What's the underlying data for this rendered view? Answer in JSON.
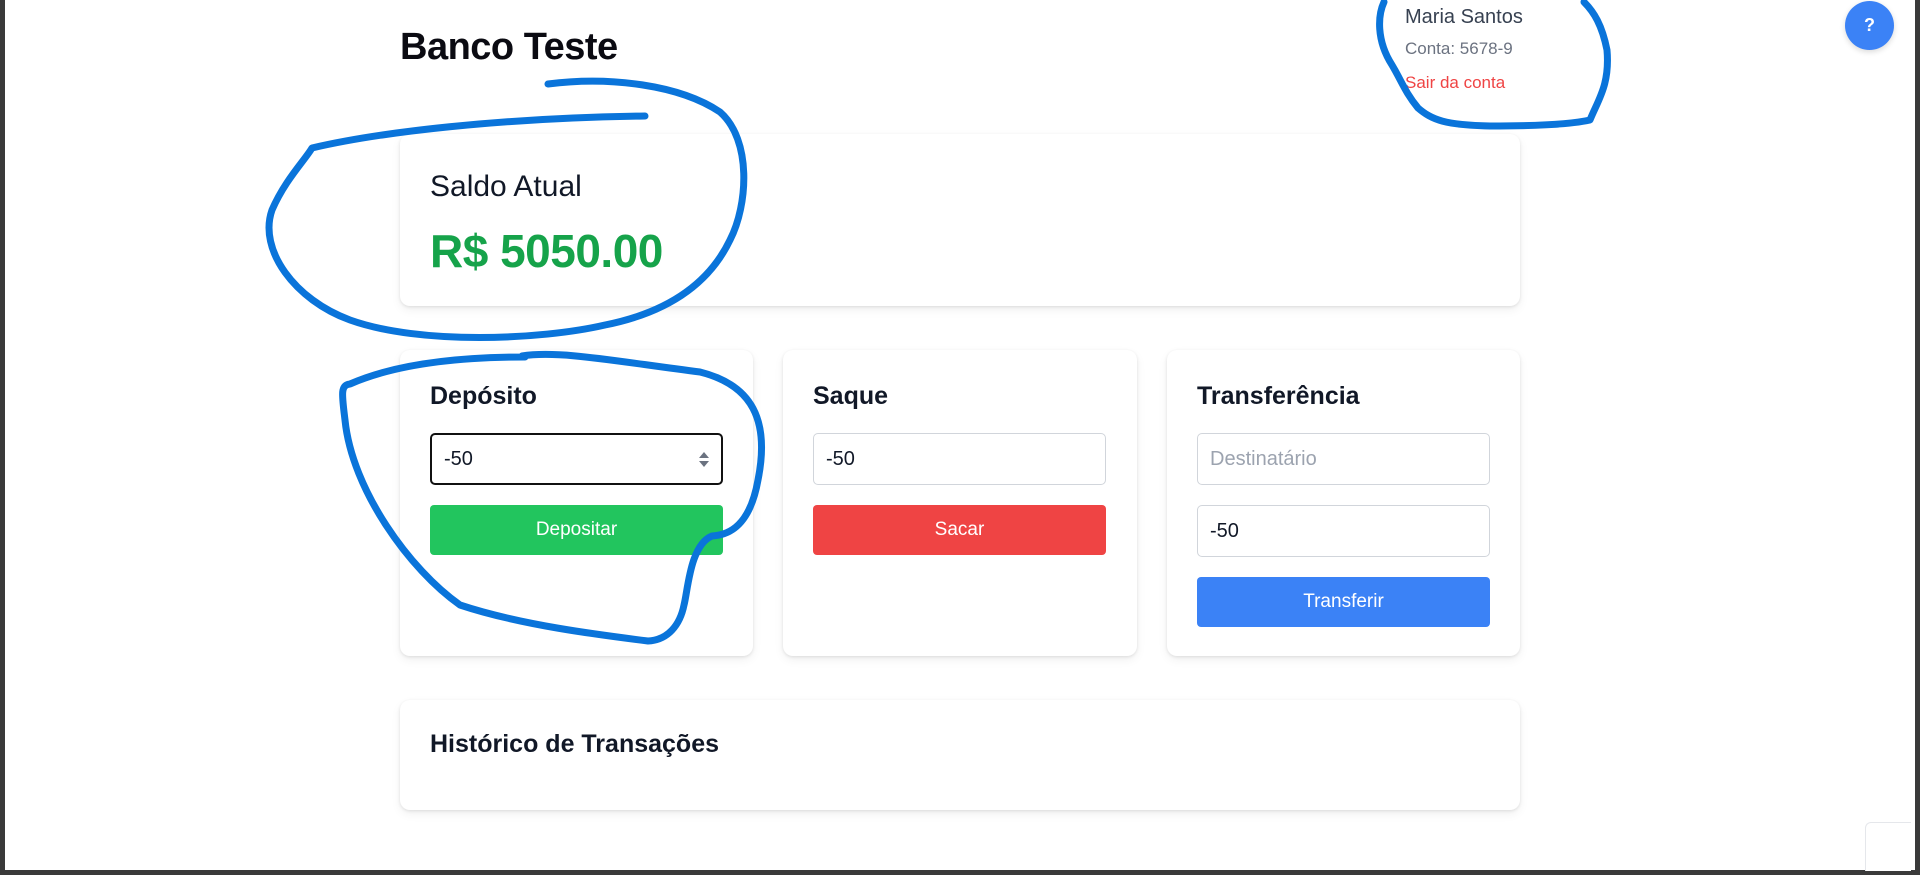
{
  "app": {
    "title": "Banco Teste"
  },
  "user": {
    "name": "Maria Santos",
    "account": "Conta: 5678-9",
    "logout_label": "Sair da conta"
  },
  "help": {
    "label": "?"
  },
  "balance": {
    "label": "Saldo Atual",
    "value": "R$ 5050.00"
  },
  "deposit": {
    "title": "Depósito",
    "amount_value": "-50",
    "button_label": "Depositar"
  },
  "withdraw": {
    "title": "Saque",
    "amount_value": "-50",
    "button_label": "Sacar"
  },
  "transfer": {
    "title": "Transferência",
    "recipient_placeholder": "Destinatário",
    "amount_value": "-50",
    "button_label": "Transferir"
  },
  "history": {
    "title": "Histórico de Transações"
  },
  "colors": {
    "balance": "#16a34a",
    "deposit_button": "#22c55e",
    "withdraw_button": "#ef4444",
    "transfer_button": "#3b82f6",
    "help_button": "#3b82f6",
    "logout_link": "#ef4444",
    "annotation_marker": "#0a74da"
  }
}
